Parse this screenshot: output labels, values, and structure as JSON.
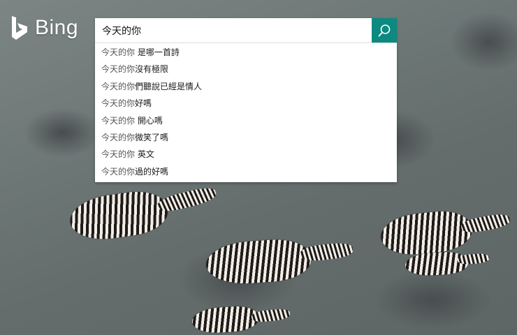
{
  "logo": {
    "text": "Bing"
  },
  "search": {
    "value": "今天的你",
    "button_icon": "search-icon"
  },
  "suggestions": [
    {
      "prefix": "今天的你",
      "rest": " 是哪一首詩"
    },
    {
      "prefix": "今天的你",
      "rest": "沒有極限"
    },
    {
      "prefix": "今天的你",
      "rest": "們聽說已經是情人"
    },
    {
      "prefix": "今天的你",
      "rest": "好嗎"
    },
    {
      "prefix": "今天的你",
      "rest": " 開心嗎"
    },
    {
      "prefix": "今天的你",
      "rest": "微笑了嗎"
    },
    {
      "prefix": "今天的你",
      "rest": " 英文"
    },
    {
      "prefix": "今天的你",
      "rest": "過的好嗎"
    }
  ],
  "colors": {
    "search_button": "#0c8a80",
    "logo": "#ffffff"
  }
}
